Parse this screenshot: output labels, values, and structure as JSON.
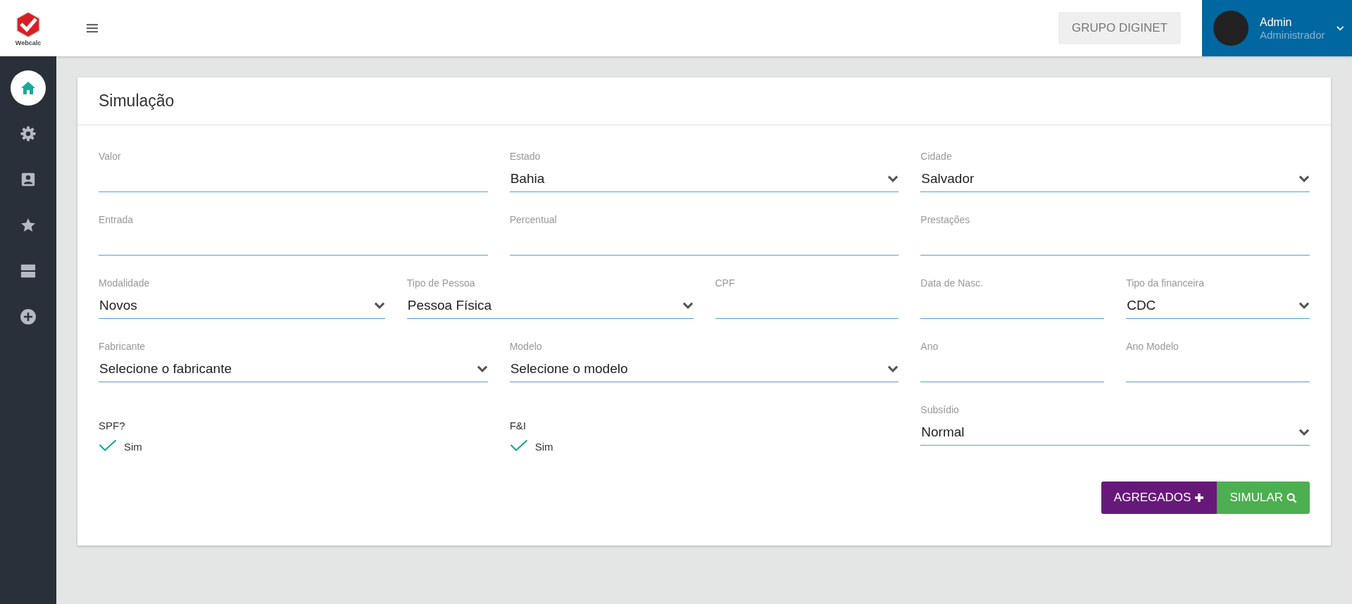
{
  "header": {
    "logo_text": "Webcalc",
    "company_button": "GRUPO DIGINET",
    "user": {
      "name": "Admin",
      "role": "Administrador"
    }
  },
  "sidebar": {
    "items": [
      {
        "selected": true
      },
      {
        "selected": false
      },
      {
        "selected": false
      },
      {
        "selected": false
      },
      {
        "selected": false
      },
      {
        "selected": false
      }
    ]
  },
  "card": {
    "title": "Simulação",
    "fields": [
      {
        "kind": "input",
        "label": "Valor"
      },
      {
        "kind": "select",
        "label": "Estado",
        "value": "Bahia"
      },
      {
        "kind": "select",
        "label": "Cidade",
        "value": "Salvador"
      },
      {
        "kind": "input",
        "label": "Entrada"
      },
      {
        "kind": "input",
        "label": "Percentual"
      },
      {
        "kind": "input",
        "label": "Prestações"
      },
      {
        "kind": "select",
        "label": "Modalidade",
        "value": "Novos"
      },
      {
        "kind": "select",
        "label": "Tipo de Pessoa",
        "value": "Pessoa Física"
      },
      {
        "kind": "input",
        "label": "CPF"
      },
      {
        "kind": "input",
        "label": "Data de Nasc."
      },
      {
        "kind": "select",
        "label": "Tipo da financeira",
        "value": "CDC"
      },
      {
        "kind": "select",
        "label": "Fabricante",
        "value": "Selecione o fabricante"
      },
      {
        "kind": "select",
        "label": "Modelo",
        "value": "Selecione o modelo"
      },
      {
        "kind": "input",
        "label": "Ano"
      },
      {
        "kind": "input",
        "label": "Ano Modelo"
      },
      {
        "kind": "checkbox",
        "label": "SPF?",
        "option": "Sim",
        "checked": true
      },
      {
        "kind": "checkbox",
        "label": "F&I",
        "option": "Sim",
        "checked": true
      },
      {
        "kind": "select",
        "label": "Subsídio",
        "value": "Normal"
      }
    ],
    "buttons": [
      {
        "kind": "add",
        "label": "AGREGADOS"
      },
      {
        "kind": "search",
        "label": "SIMULAR"
      }
    ]
  }
}
